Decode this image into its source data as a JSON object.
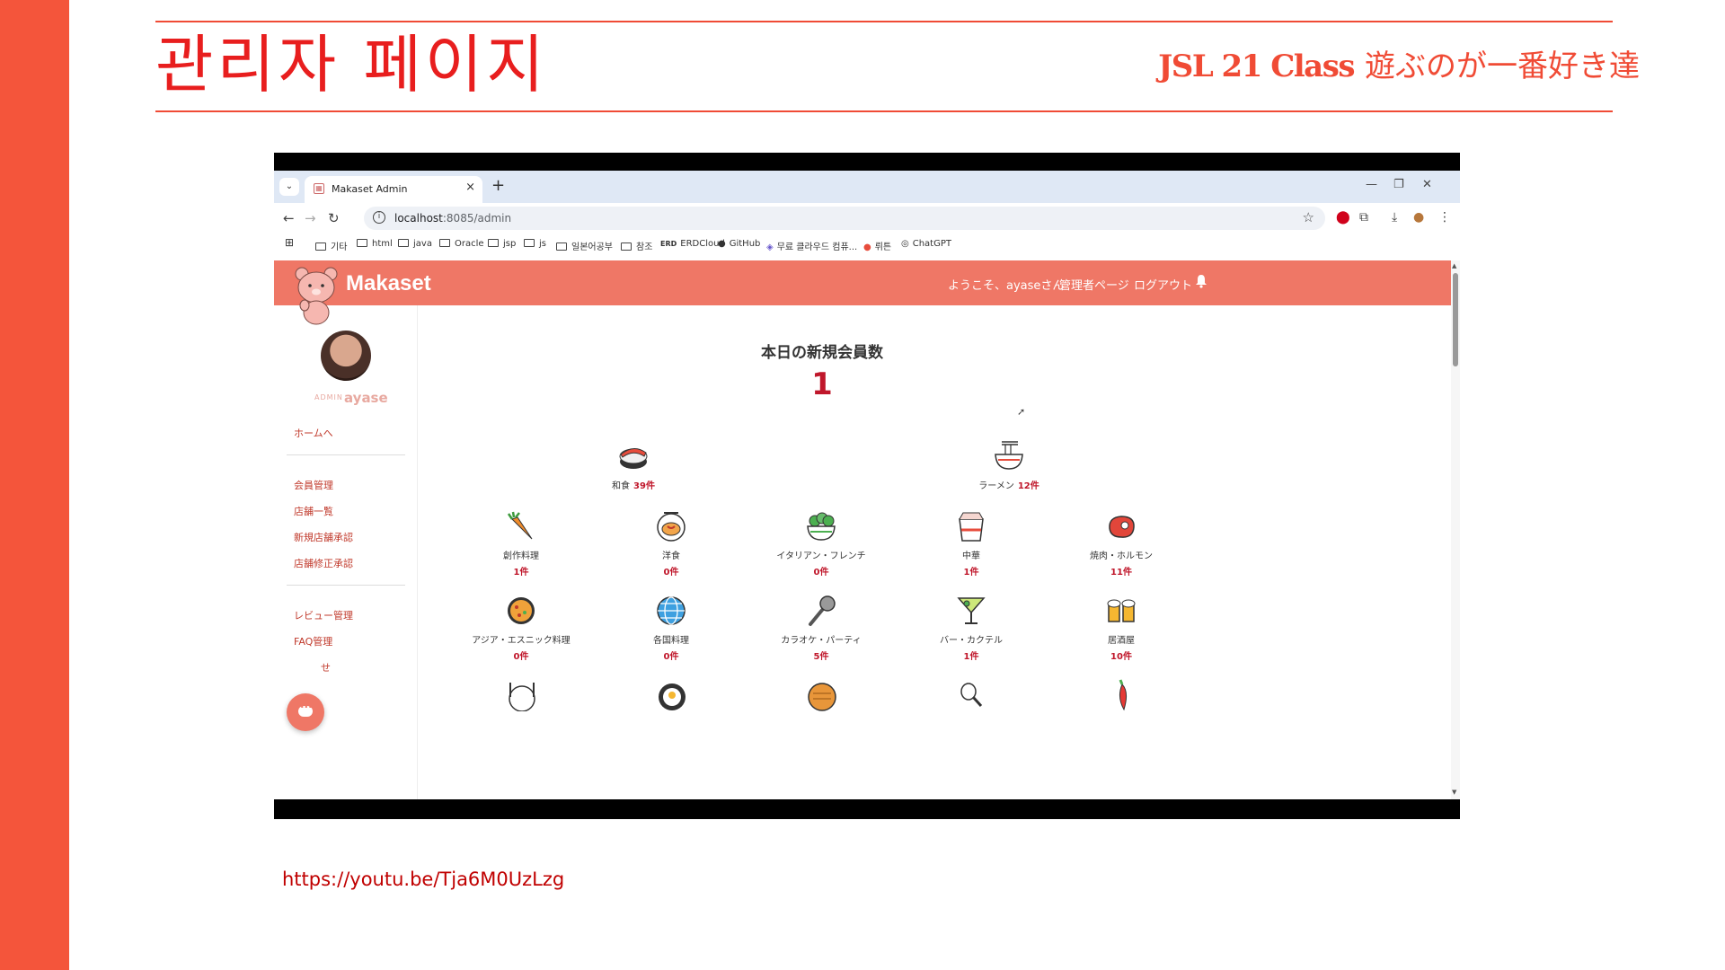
{
  "slide": {
    "title": "관리자 페이지",
    "subtitle_bold": "JSL 21 Class",
    "subtitle_rest": "遊ぶのが一番好き達",
    "video_link": "https://youtu.be/Tja6M0UzLzg"
  },
  "browser": {
    "tab_title": "Makaset Admin",
    "url_host": "localhost",
    "url_rest": ":8085/admin",
    "bookmarks": [
      "기타",
      "html",
      "java",
      "Oracle",
      "jsp",
      "js",
      "일본어공부",
      "참조",
      "ERDCloud",
      "GitHub",
      "무료 클라우드 컴퓨...",
      "뤼튼",
      "ChatGPT"
    ]
  },
  "app": {
    "brand": "Makaset",
    "nav": {
      "welcome": "ようこそ、ayaseさん",
      "admin_page": "管理者ページ",
      "logout": "ログアウト"
    },
    "sidebar": {
      "admin_label": "ADMIN",
      "admin_name": "ayase",
      "home": "ホームへ",
      "items": [
        "会員管理",
        "店舗一覧",
        "新規店舗承認",
        "店舗修正承認"
      ],
      "items2": [
        "レビュー管理",
        "FAQ管理",
        "せ"
      ]
    },
    "stat": {
      "title": "本日の新規会員数",
      "value": "1"
    },
    "categories_top": [
      {
        "name": "和食",
        "count": "39件",
        "icon": "sushi-icon"
      },
      {
        "name": "ラーメン",
        "count": "12件",
        "icon": "ramen-icon"
      }
    ],
    "categories": [
      {
        "name": "創作料理",
        "count": "1件",
        "icon": "carrot-icon"
      },
      {
        "name": "洋食",
        "count": "0件",
        "icon": "omelet-icon"
      },
      {
        "name": "イタリアン・フレンチ",
        "count": "0件",
        "icon": "salad-icon"
      },
      {
        "name": "中華",
        "count": "1件",
        "icon": "takeout-box-icon"
      },
      {
        "name": "焼肉・ホルモン",
        "count": "11件",
        "icon": "meat-icon"
      },
      {
        "name": "アジア・エスニック料理",
        "count": "0件",
        "icon": "paella-icon"
      },
      {
        "name": "各国料理",
        "count": "0件",
        "icon": "globe-icon"
      },
      {
        "name": "カラオケ・パーティ",
        "count": "5件",
        "icon": "microphone-icon"
      },
      {
        "name": "バー・カクテル",
        "count": "1件",
        "icon": "cocktail-icon"
      },
      {
        "name": "居酒屋",
        "count": "10件",
        "icon": "beer-icon"
      }
    ],
    "colors": {
      "header": "#ef7766",
      "accent": "#c0172b",
      "slide_accent": "#f4553b"
    }
  }
}
